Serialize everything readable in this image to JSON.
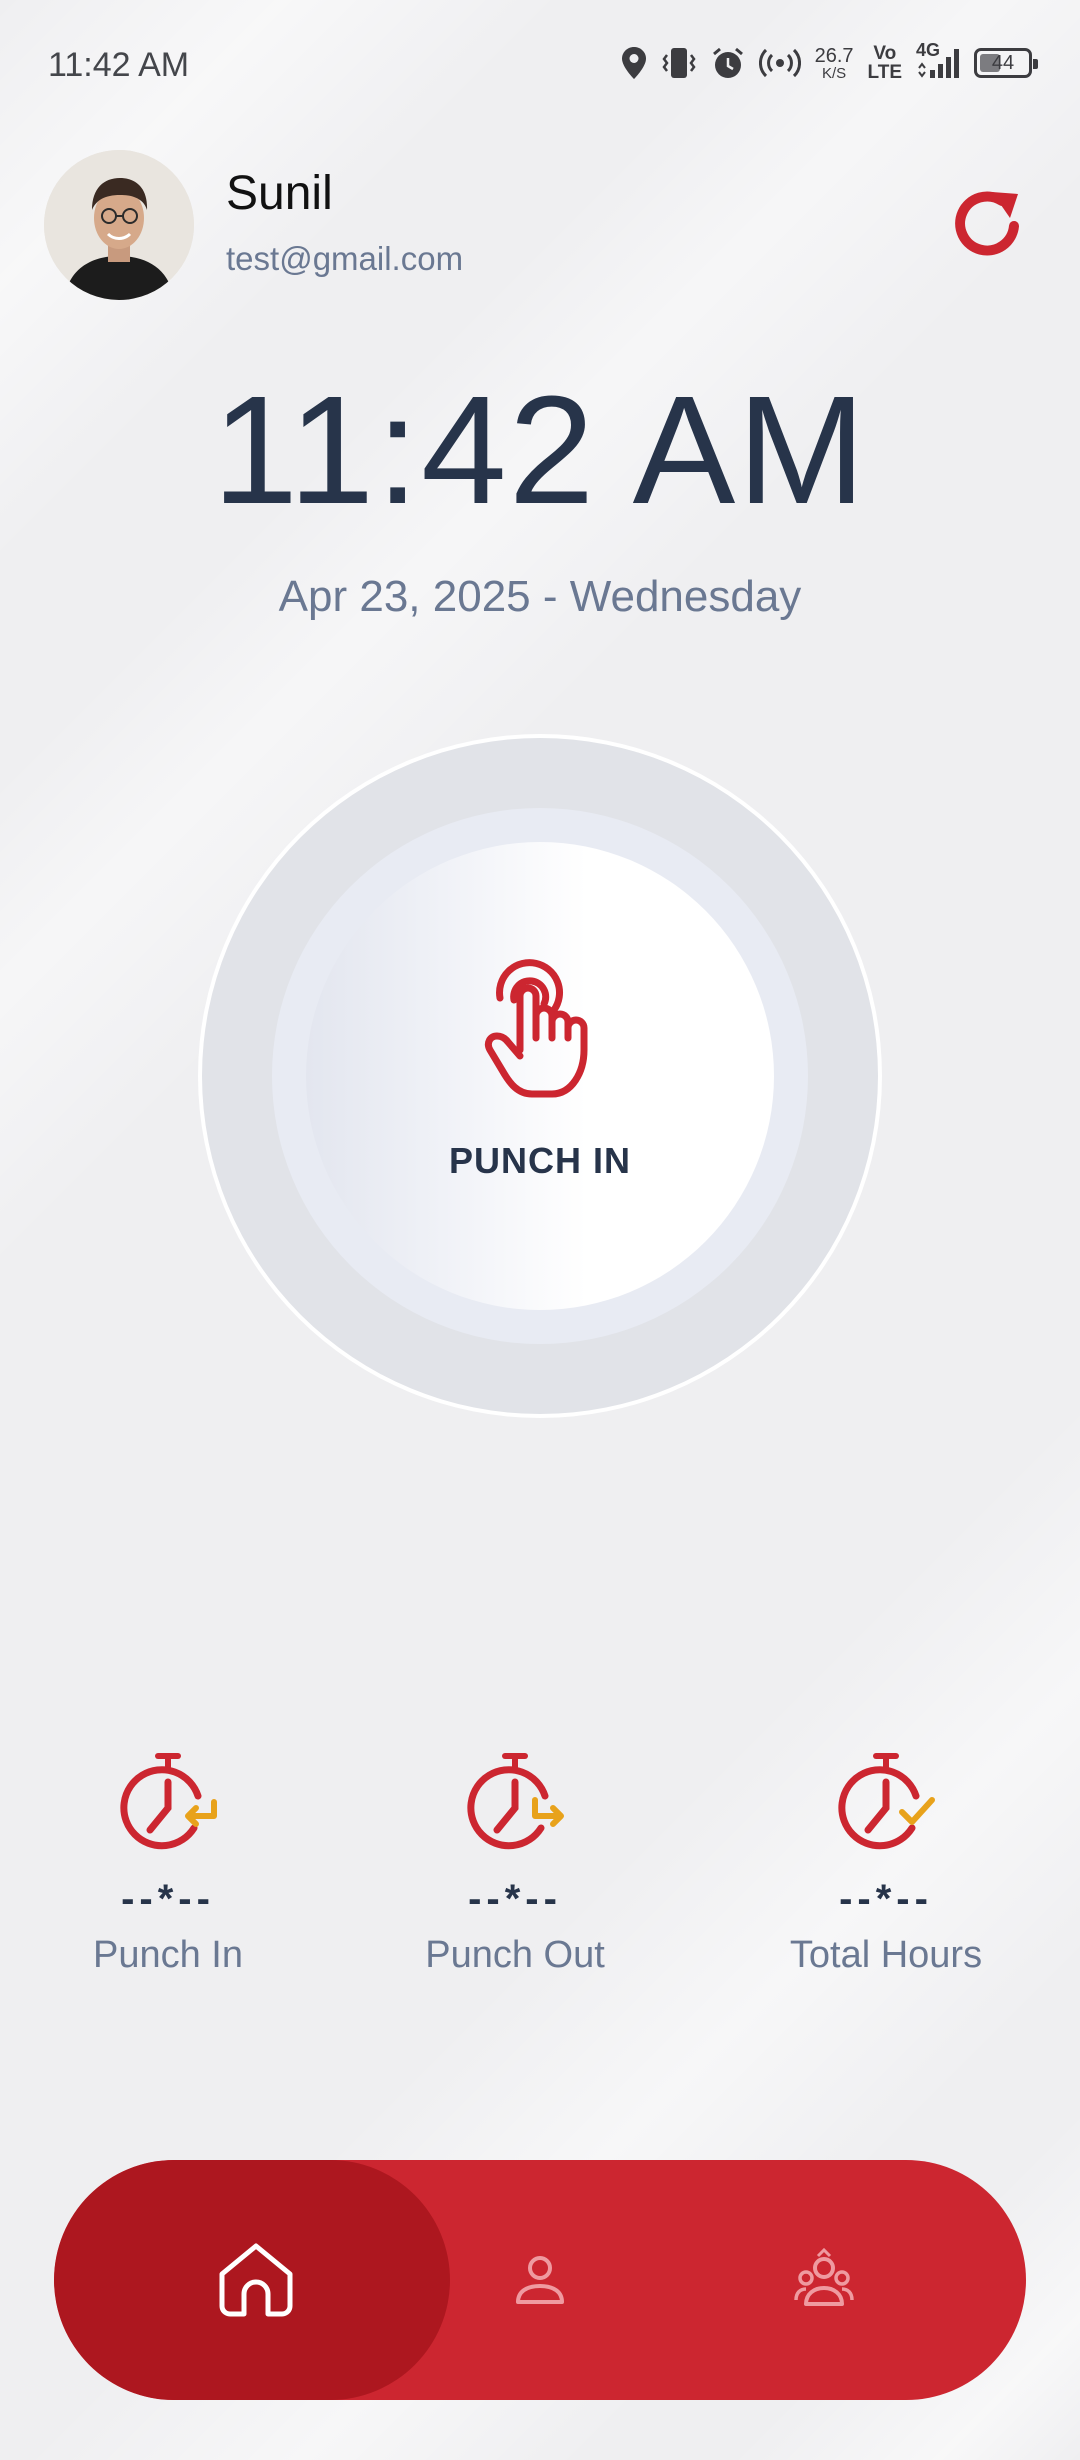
{
  "status_bar": {
    "time": "11:42 AM",
    "net_speed": "26.7",
    "net_unit": "K/S",
    "volte_top": "Vo",
    "volte_bottom": "LTE",
    "network": "4G",
    "battery": "44",
    "battery_level": 0.44,
    "icons": [
      "location-icon",
      "vibrate-icon",
      "alarm-icon",
      "hotspot-icon",
      "signal-icon",
      "battery-icon"
    ]
  },
  "user": {
    "name": "Sunil",
    "email": "test@gmail.com"
  },
  "clock": {
    "time": "11:42 AM",
    "date": "Apr 23, 2025 - Wednesday"
  },
  "punch_button": {
    "label": "PUNCH IN",
    "icon": "hand-tap-icon"
  },
  "stats": [
    {
      "icon": "stopwatch-in-icon",
      "value": "--*--",
      "label": "Punch In"
    },
    {
      "icon": "stopwatch-out-icon",
      "value": "--*--",
      "label": "Punch Out"
    },
    {
      "icon": "stopwatch-check-icon",
      "value": "--*--",
      "label": "Total Hours"
    }
  ],
  "bottom_nav": {
    "items": [
      {
        "icon": "home-icon",
        "active": true
      },
      {
        "icon": "profile-icon",
        "active": false
      },
      {
        "icon": "team-icon",
        "active": false
      }
    ]
  },
  "colors": {
    "accent": "#cc2630",
    "accent_dark": "#ad171f",
    "text_dark": "#27344a",
    "text_muted": "#6a7892",
    "icon_orange": "#e8a21b",
    "background": "#efeff1"
  }
}
